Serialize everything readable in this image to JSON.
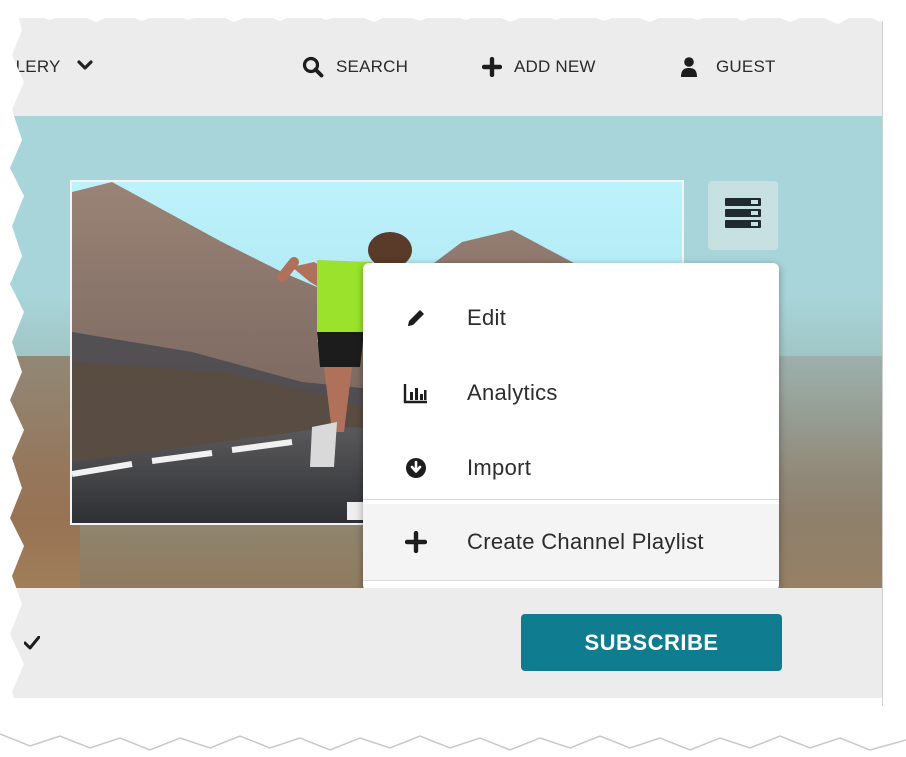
{
  "nav": {
    "gallery_label": "LLERY",
    "search_label": "SEARCH",
    "add_new_label": "ADD NEW",
    "guest_label": "GUEST"
  },
  "dropdown": {
    "items": [
      {
        "label": "Edit",
        "icon": "pencil-icon"
      },
      {
        "label": "Analytics",
        "icon": "bar-chart-icon"
      },
      {
        "label": "Import",
        "icon": "download-circle-icon"
      },
      {
        "label": "Create Channel Playlist",
        "icon": "plus-icon"
      }
    ]
  },
  "subscribe": {
    "label": "SUBSCRIBE"
  },
  "colors": {
    "nav_bg": "#ececec",
    "banner_bg": "#a8d5d9",
    "subscribe_bg": "#0f7d8f",
    "menu_toggle_bg": "#c7e0e2"
  }
}
